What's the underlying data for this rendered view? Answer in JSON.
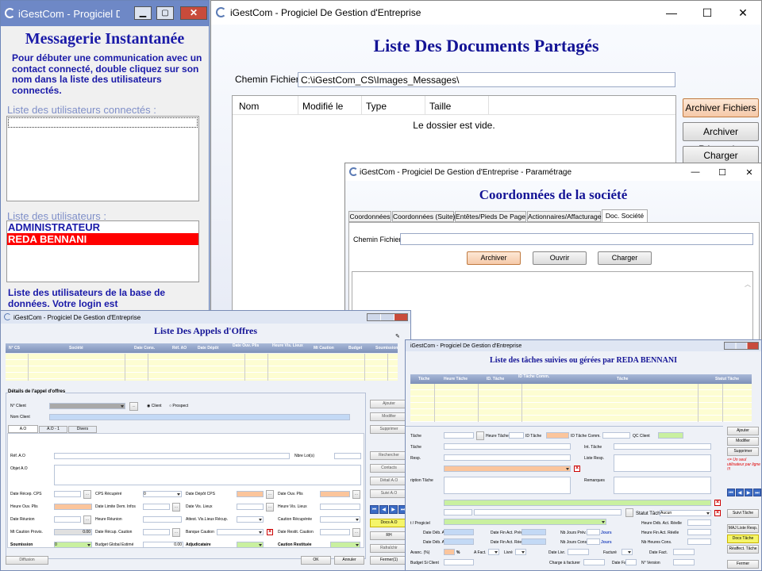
{
  "messenger": {
    "title": "iGestCom - Progiciel De Gestion d'Entreprise",
    "heading": "Messagerie Instantanée",
    "intro": "Pour débuter une communication avec un contact connecté, double cliquez sur son nom dans la liste des utilisateurs connectés.",
    "connected_label": "Liste des utilisateurs connectés :",
    "users_label": "Liste des utilisateurs :",
    "users": [
      "ADMINISTRATEUR",
      "REDA BENNANI"
    ],
    "db_text": "Liste des utilisateurs de la base de données. Votre login est"
  },
  "docs": {
    "title": "iGestCom - Progiciel De Gestion d'Entreprise",
    "heading": "Liste Des Documents Partagés",
    "path_label": "Chemin Fichier",
    "path_value": "C:\\iGestCom_CS\\Images_Messages\\",
    "columns": [
      "Nom",
      "Modifié le",
      "Type",
      "Taille"
    ],
    "empty": "Le dossier est vide.",
    "buttons": [
      "Archiver Fichiers",
      "Archiver Répertoire",
      "Charger"
    ]
  },
  "param": {
    "title": "iGestCom - Progiciel De Gestion d'Entreprise - Paramétrage",
    "heading": "Coordonnées de la société",
    "tabs": [
      "Coordonnées",
      "Coordonnées (Suite)",
      "Entêtes/Pieds De Page",
      "Actionnaires/Affacturage",
      "Doc. Société"
    ],
    "path_label": "Chemin Fichier",
    "buttons": [
      "Archiver",
      "Ouvrir",
      "Charger"
    ]
  },
  "ao": {
    "title": "iGestCom - Progiciel De Gestion d'Entreprise",
    "heading": "Liste Des Appels d'Offres",
    "columns": [
      "N° CS",
      "Société",
      "Date Cons.",
      "Réf. AO",
      "Date Dépôt",
      "Date Ouv. Plis",
      "Heure Vis. Lieux",
      "Mt Caution",
      "Budget",
      "Soumission"
    ],
    "section": "Détails de l'appel d'offres",
    "client_label": "N° Client",
    "radio_client": "Client",
    "radio_prospect": "Prospect",
    "nom_label": "Nom Client",
    "tabs": [
      "A.O",
      "A.O - 1",
      "Divers"
    ],
    "ref_label": "Réf. A.O",
    "lot_label": "Nbre Lot(s)",
    "objet_label": "Objet A.O",
    "rows": [
      [
        "Date Récep. CPS",
        "CPS Récupéré",
        "Date Dépôt CPS",
        "Date Ouv. Plis"
      ],
      [
        "Heure Ouv. Plis",
        "Date Limite Dem. Infos",
        "Date Vis. Lieux",
        "Heure Vis. Lieux"
      ],
      [
        "Date Réunion",
        "Heure Réunion",
        "Attest. Vis.Lieux Récup.",
        "Caution Récupérée"
      ],
      [
        "Mt Caution Provis.",
        "Date Récup. Caution",
        "Banque Caution",
        "Date Restit. Caution"
      ],
      [
        "Soumission",
        "Budget Global Estimé",
        "Adjudicataire",
        "Caution Restituée"
      ]
    ],
    "zero": "0",
    "amount": "0.00",
    "side_buttons": [
      "Ajouter",
      "Modifier",
      "Supprimer",
      "Rechercher",
      "Contacts",
      "Détail A.O",
      "Suivi A.O",
      "Docs A.O",
      "RH",
      "Rafraîchir"
    ],
    "ok": "OK",
    "cancel": "Annuler",
    "close": "Fermer(1)",
    "diffusion": "Diffusion"
  },
  "tasks": {
    "title": "iGestCom - Progiciel De Gestion d'Entreprise",
    "heading": "Liste des tâches suivies ou gérées par REDA BENNANI",
    "columns": [
      "Tâche",
      "Heure Tâche",
      "ID. Tâche",
      "ID Tâche Comm.",
      "Tâche",
      "Statut Tâche"
    ],
    "labels": [
      "Tâche",
      "Heure Tâche",
      "ID Tâche",
      "ID Tâche Comm.",
      "QC Client",
      "Tâche",
      "Int. Tâche",
      "Resp.",
      "Liste Resp.",
      "ription Tâche",
      "Remarques",
      "Statut Tâche",
      "Aucun",
      "Heure Déb. Act. Réelle",
      "Date Déb. Act. Prév",
      "Date Fin Act. Prév",
      "Nb Jours Prév.",
      "Heure Fin Act. Réelle",
      "Date Déb. Act. Réelle",
      "Date Fin Act. Réelle",
      "Nb Jours Cons.",
      "Nb Heures Cons.",
      "Jours",
      "Avanc. (%)",
      "A Fact.",
      "Livré",
      "Date Livr.",
      "Facturé",
      "Date Fact.",
      "Budget Si Client",
      "Charge à facturer",
      "Date Fact.",
      "N° Version",
      "t / Progiciel"
    ],
    "side_buttons": [
      "Ajouter",
      "Modifier",
      "Supprimer",
      "Suivi Tâche",
      "MAJ Liste Resp.",
      "Docs Tâche",
      "Réaffect. Tâche",
      "Fermer"
    ],
    "note": "<= Un seul utilisateur par ligne !!!"
  }
}
